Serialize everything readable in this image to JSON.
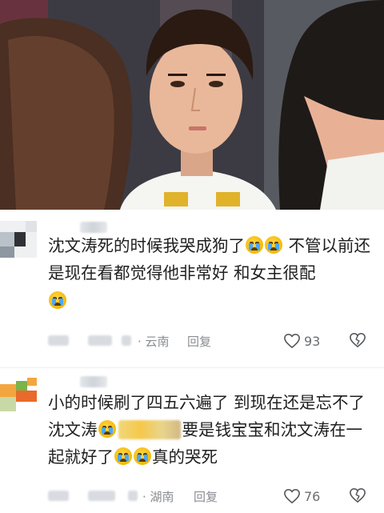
{
  "video": {
    "palette": {
      "uniform": "#f5f5f2",
      "skin": "#e9b89a",
      "hair": "#2b1a12",
      "bg": "#3c3b43"
    }
  },
  "comments": [
    {
      "text_parts": [
        "沈文涛死的时候我哭成狗了",
        "不管以前还是现在看都觉得他非常好 和女主很配"
      ],
      "location": "· 云南",
      "reply_label": "回复",
      "like_count": "93",
      "avatar_colors": [
        "#dfe3e7",
        "#aab3bb",
        "#2f3136",
        "#8d97a1",
        "#eff1f3"
      ]
    },
    {
      "text_parts": [
        "小的时候刷了四五六遍了  到现在还是忘不了沈文涛",
        "要是钱宝宝和沈文涛在一起就好了",
        "真的哭死"
      ],
      "location": "· 湖南",
      "reply_label": "回复",
      "like_count": "76",
      "avatar_colors": [
        "#f3a640",
        "#7cb34a",
        "#e96a2a",
        "#c9d9a6",
        "#ffffff"
      ]
    }
  ],
  "icons": {
    "like": "heart-outline-icon",
    "dislike": "broken-heart-icon",
    "crying": "loudly-crying-face-emoji"
  }
}
